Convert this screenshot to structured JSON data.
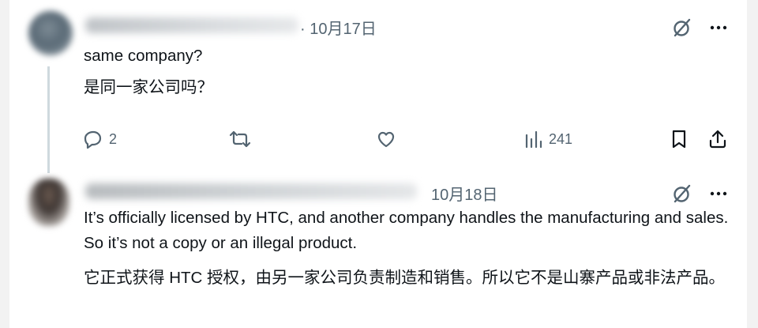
{
  "tweets": [
    {
      "date": "· 10月17日",
      "text_en": "same company?",
      "text_zh": "是同一家公司吗？",
      "replies": "2",
      "views": "241"
    },
    {
      "date": "10月18日",
      "text_en": "It’s officially licensed by HTC, and another company handles the manufacturing and sales. So it’s not a copy or an illegal product.",
      "text_zh": "它正式获得 HTC 授权，由另一家公司负责制造和销售。所以它不是山寨产品或非法产品。"
    }
  ],
  "icons": {
    "grok": "grok-icon",
    "more": "more-icon",
    "reply": "reply-icon",
    "retweet": "retweet-icon",
    "like": "heart-icon",
    "views": "views-icon",
    "bookmark": "bookmark-icon",
    "share": "share-icon"
  },
  "colors": {
    "text": "#0f1419",
    "muted": "#536471",
    "thread_line": "#cfd9de",
    "background": "#ffffff"
  }
}
